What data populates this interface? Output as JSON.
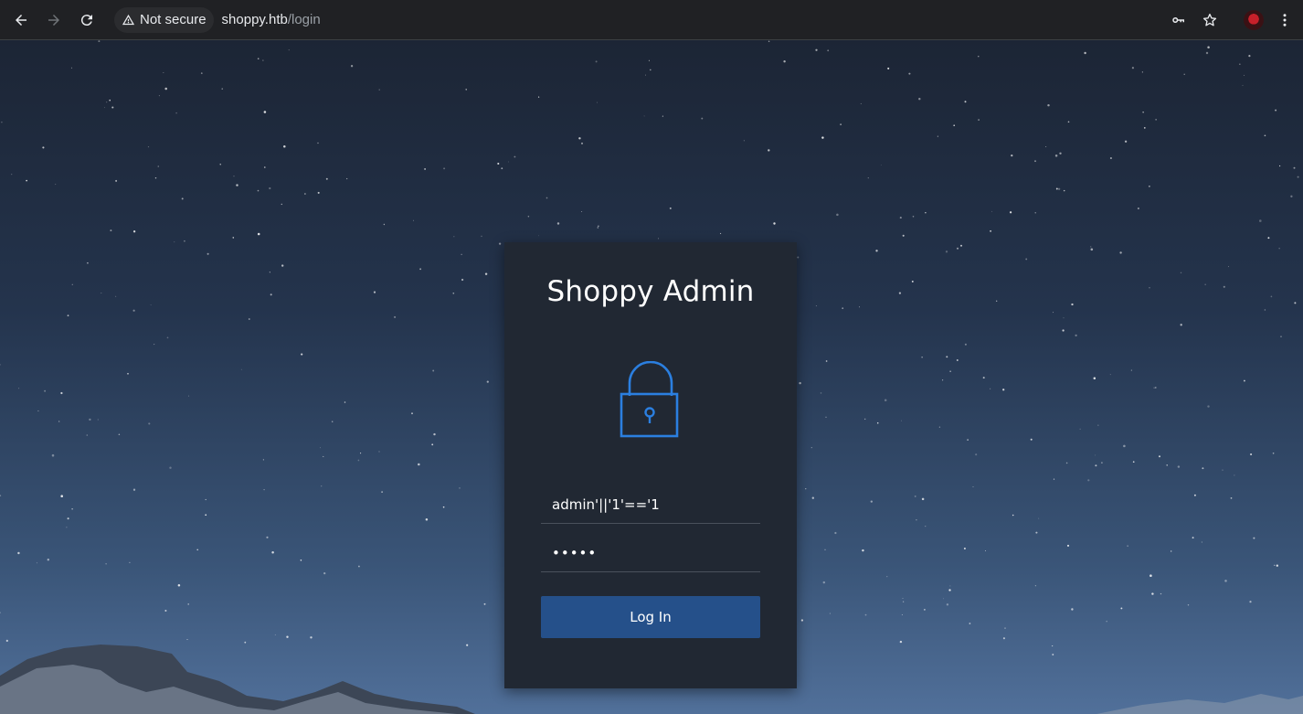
{
  "browser": {
    "security_label": "Not secure",
    "url_host": "shoppy.htb",
    "url_path": "/login",
    "icons": [
      "back-icon",
      "forward-icon",
      "reload-icon",
      "warning-icon",
      "key-icon",
      "star-icon",
      "profile-avatar",
      "menu-icon"
    ]
  },
  "login": {
    "title": "Shoppy Admin",
    "username_value": "admin'||'1'=='1",
    "password_value": "•••••",
    "button_label": "Log In",
    "accent_color": "#2b7fe0",
    "button_color": "#25508a"
  }
}
